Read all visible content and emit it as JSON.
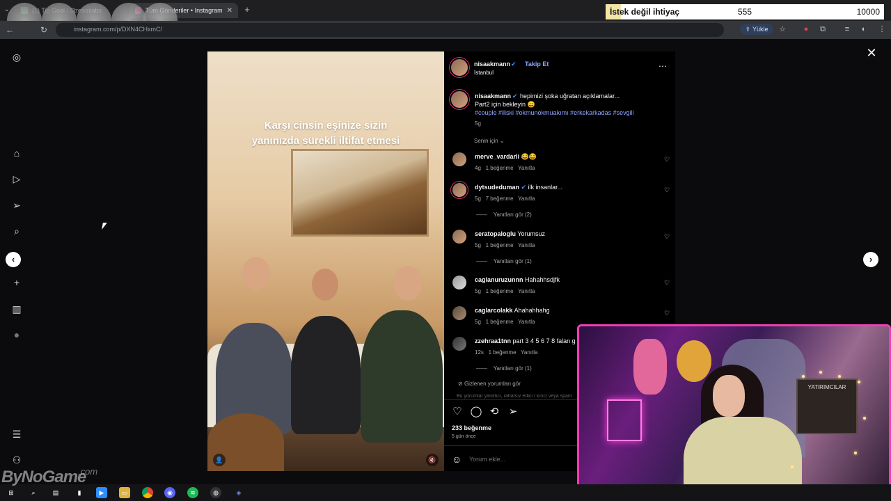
{
  "browser": {
    "tabs": [
      {
        "label": "(1) Tip Goal / Streamlabs"
      },
      {
        "label": "Tüm Gönderiler • Instagram"
      }
    ],
    "url": "instagram.com/p/DXN4CHxmC/",
    "yukle_label": "Yükle"
  },
  "goal_widget": {
    "label": "İstek değil ihtiyaç",
    "current": "555",
    "target": "10000"
  },
  "post": {
    "media_caption_line1": "Karşı cinsin eşinize sizin",
    "media_caption_line2": "yanınızda sürekli  iltifat etmesi",
    "author": "nisaakmann",
    "follow_label": "Takip Et",
    "location": "İstanbul",
    "caption_text": "hepimizi şoka uğratan açıklamalar...",
    "caption_line2": "Part2 için bekleyin 😄",
    "hashtags": "#couple #iliski #okmunokmuakımı #erkekarkadas #sevgili",
    "caption_time": "5g",
    "sort_label": "Senin için",
    "likes": "233 beğenme",
    "posted_ago": "5 gün önce",
    "comment_placeholder": "Yorum ekle..."
  },
  "comments": [
    {
      "user": "merve_vardarli",
      "text": "😂😂",
      "time": "4g",
      "likes": "1 beğenme",
      "reply": "Yanıtla"
    },
    {
      "user": "dytsudeduman",
      "text": "ilk insanlar...",
      "time": "5g",
      "likes": "7 beğenme",
      "reply": "Yanıtla",
      "view_replies": "Yanıtları gör (2)"
    },
    {
      "user": "seratopaloglu",
      "text": "Yorumsuz",
      "time": "5g",
      "likes": "1 beğenme",
      "reply": "Yanıtla",
      "view_replies": "Yanıtları gör (1)"
    },
    {
      "user": "caglanuruzunnn",
      "text": "Hahahhsdjfk",
      "time": "5g",
      "likes": "1 beğenme",
      "reply": "Yanıtla"
    },
    {
      "user": "caglarcolakk",
      "text": "Ahahahhahg",
      "time": "5g",
      "likes": "1 beğenme",
      "reply": "Yanıtla"
    },
    {
      "user": "zzehraa1tnn",
      "text": "part 3 4 5 6 7 8 falan g",
      "time": "12s",
      "likes": "1 beğenme",
      "reply": "Yanıtla",
      "view_replies": "Yanıtları gör (1)"
    }
  ],
  "hidden_comments_label": "Gizlenen yorumları gör",
  "hidden_comments_note": "Bu yorumlar yanıltıcı, rahatsız edici / kırıcı veya spam",
  "webcam_board_text": "YATIRIMCILAR",
  "watermark": {
    "brand": "ByNoGame",
    "tld": ".com"
  },
  "icons": {
    "sidebar": [
      "instagram-icon",
      "home-icon",
      "reels-icon",
      "send-icon",
      "search-icon",
      "explore-icon",
      "create-icon",
      "insights-icon",
      "profile-icon",
      "menu-icon",
      "more-icon"
    ],
    "actions": [
      "heart-icon",
      "comment-icon",
      "repost-icon",
      "share-icon"
    ]
  },
  "colors": {
    "accent_link": "#8fa6ff",
    "verified": "#3897f0",
    "webcam_border": "#f03db3"
  }
}
